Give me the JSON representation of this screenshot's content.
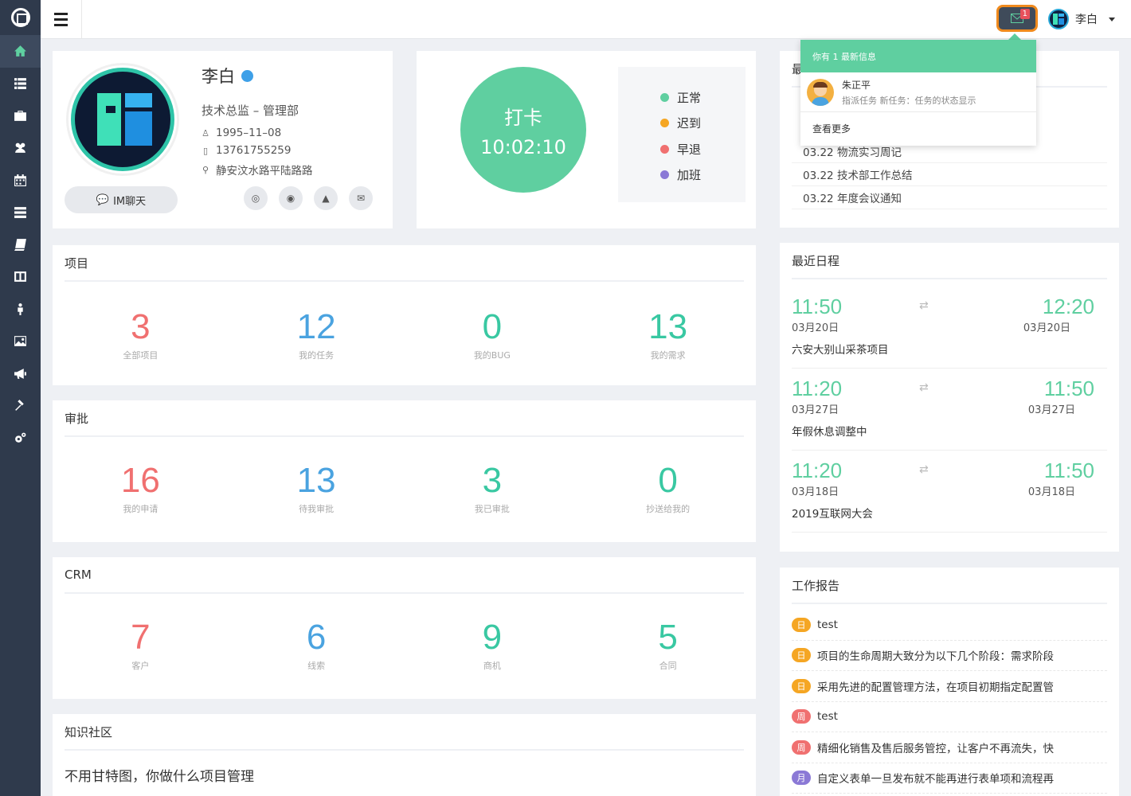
{
  "colors": {
    "accent": "#5fcfa0",
    "sidebar_bg": "#2f3a4c",
    "red": "#f07070",
    "blue": "#4aa3e0",
    "green": "#39c8a2",
    "orange": "#f5a623",
    "purple": "#8b79d6"
  },
  "sidebar": {
    "items": [
      {
        "icon": "home-icon"
      },
      {
        "icon": "list-icon"
      },
      {
        "icon": "briefcase-icon"
      },
      {
        "icon": "users-icon"
      },
      {
        "icon": "calendar-icon"
      },
      {
        "icon": "server-icon"
      },
      {
        "icon": "book-icon"
      },
      {
        "icon": "columns-icon"
      },
      {
        "icon": "person-icon"
      },
      {
        "icon": "image-icon"
      },
      {
        "icon": "megaphone-icon"
      },
      {
        "icon": "gavel-icon"
      },
      {
        "icon": "settings-icon"
      }
    ]
  },
  "topbar": {
    "mail_badge": "1",
    "username": "李白"
  },
  "dropdown": {
    "header": "你有 1 最新信息",
    "item_name": "朱正平",
    "item_desc": "指派任务  新任务：任务的状态显示",
    "more": "查看更多"
  },
  "profile": {
    "name": "李白",
    "role": "技术总监 – 管理部",
    "birthday": "1995–11–08",
    "phone": "13761755259",
    "address": "静安汶水路平陆路路",
    "im_button": "IM聊天"
  },
  "clockin": {
    "label": "打卡",
    "time": "10:02:10",
    "legend": [
      {
        "label": "正常",
        "color": "#5fcfa0"
      },
      {
        "label": "迟到",
        "color": "#f5a623"
      },
      {
        "label": "早退",
        "color": "#f07070"
      },
      {
        "label": "加班",
        "color": "#8b79d6"
      }
    ]
  },
  "news": {
    "title_partial": "最",
    "items": [
      "03.22 物流实习周记",
      "03.22 技术部工作总结",
      "03.22 年度会议通知"
    ]
  },
  "projects": {
    "title": "项目",
    "stats": [
      {
        "num": "3",
        "label": "全部项目",
        "color": "#f07070"
      },
      {
        "num": "12",
        "label": "我的任务",
        "color": "#4aa3e0"
      },
      {
        "num": "0",
        "label": "我的BUG",
        "color": "#39c8a2"
      },
      {
        "num": "13",
        "label": "我的需求",
        "color": "#39c8a2"
      }
    ]
  },
  "approval": {
    "title": "审批",
    "stats": [
      {
        "num": "16",
        "label": "我的申请",
        "color": "#f07070"
      },
      {
        "num": "13",
        "label": "待我审批",
        "color": "#4aa3e0"
      },
      {
        "num": "3",
        "label": "我已审批",
        "color": "#39c8a2"
      },
      {
        "num": "0",
        "label": "抄送给我的",
        "color": "#39c8a2"
      }
    ]
  },
  "crm": {
    "title": "CRM",
    "stats": [
      {
        "num": "7",
        "label": "客户",
        "color": "#f07070"
      },
      {
        "num": "6",
        "label": "线索",
        "color": "#4aa3e0"
      },
      {
        "num": "9",
        "label": "商机",
        "color": "#39c8a2"
      },
      {
        "num": "5",
        "label": "合同",
        "color": "#39c8a2"
      }
    ]
  },
  "knowledge": {
    "title": "知识社区",
    "first_item": "不用甘特图，你做什么项目管理"
  },
  "schedule": {
    "title": "最近日程",
    "items": [
      {
        "start": "11:50",
        "start_date": "03月20日",
        "end": "12:20",
        "end_date": "03月20日",
        "title": "六安大别山采茶项目"
      },
      {
        "start": "11:20",
        "start_date": "03月27日",
        "end": "11:50",
        "end_date": "03月27日",
        "title": "年假休息调整中"
      },
      {
        "start": "11:20",
        "start_date": "03月18日",
        "end": "11:50",
        "end_date": "03月18日",
        "title": "2019互联网大会"
      }
    ],
    "swap_icon": "⇄"
  },
  "reports": {
    "title": "工作报告",
    "items": [
      {
        "tag": "日",
        "color": "#f5a623",
        "text": "test"
      },
      {
        "tag": "日",
        "color": "#f5a623",
        "text": "项目的生命周期大致分为以下几个阶段：需求阶段"
      },
      {
        "tag": "日",
        "color": "#f5a623",
        "text": "采用先进的配置管理方法，在项目初期指定配置管"
      },
      {
        "tag": "周",
        "color": "#f07070",
        "text": "test"
      },
      {
        "tag": "周",
        "color": "#f07070",
        "text": "精细化销售及售后服务管控，让客户不再流失，快"
      },
      {
        "tag": "月",
        "color": "#8b79d6",
        "text": "自定义表单一旦发布就不能再进行表单项和流程再"
      }
    ]
  }
}
